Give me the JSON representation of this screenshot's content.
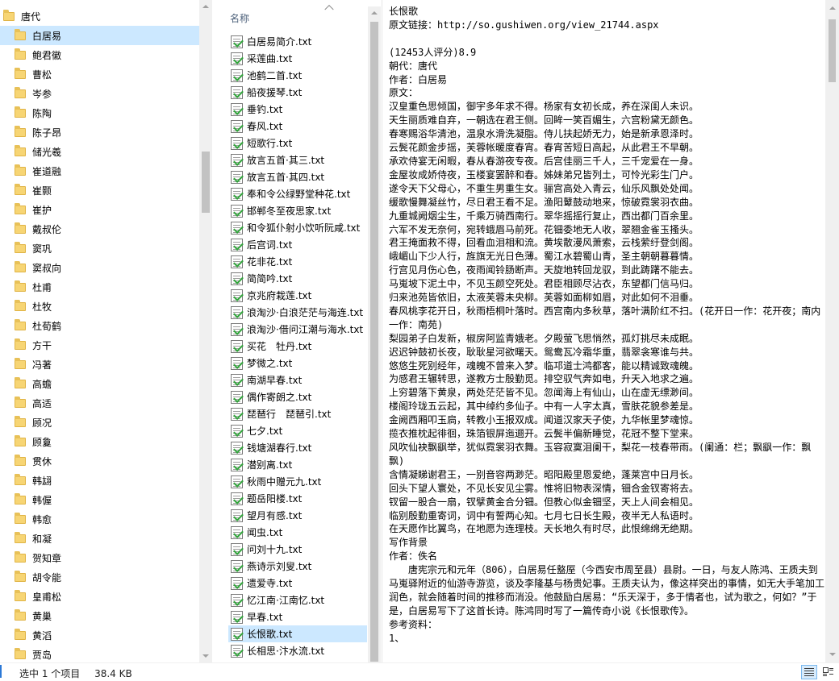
{
  "folder_tree": {
    "root": "唐代",
    "items": [
      "白居易",
      "鲍君徽",
      "曹松",
      "岑参",
      "陈陶",
      "陈子昂",
      "储光羲",
      "崔道融",
      "崔颢",
      "崔护",
      "戴叔伦",
      "窦巩",
      "窦叔向",
      "杜甫",
      "杜牧",
      "杜荀鹤",
      "方干",
      "冯著",
      "高蟾",
      "高适",
      "顾况",
      "顾敻",
      "贯休",
      "韩翃",
      "韩偓",
      "韩愈",
      "和凝",
      "贺知章",
      "胡令能",
      "皇甫松",
      "黄巢",
      "黄滔",
      "贾岛"
    ],
    "selected_index": 0
  },
  "file_list": {
    "column_header": "名称",
    "items": [
      "白居易简介.txt",
      "采莲曲.txt",
      "池鹤二首.txt",
      "船夜援琴.txt",
      "垂钓.txt",
      "春风.txt",
      "短歌行.txt",
      "放言五首·其三.txt",
      "放言五首·其四.txt",
      "奉和令公绿野堂种花.txt",
      "邯郸冬至夜思家.txt",
      "和令狐仆射小饮听阮咸.txt",
      "后宫词.txt",
      "花非花.txt",
      "简简吟.txt",
      "京兆府栽莲.txt",
      "浪淘沙·白浪茫茫与海连.txt",
      "浪淘沙·借问江潮与海水.txt",
      "买花　牡丹.txt",
      "梦微之.txt",
      "南湖早春.txt",
      "偶作寄朗之.txt",
      "琵琶行　琵琶引.txt",
      "七夕.txt",
      "钱塘湖春行.txt",
      "潜别离.txt",
      "秋雨中赠元九.txt",
      "题岳阳楼.txt",
      "望月有感.txt",
      "闻虫.txt",
      "问刘十九.txt",
      "燕诗示刘叟.txt",
      "遗爱寺.txt",
      "忆江南·江南忆.txt",
      "早春.txt",
      "长恨歌.txt",
      "长相思·汴水流.txt"
    ],
    "selected_index": 35
  },
  "preview": {
    "lines": [
      "长恨歌",
      "原文链接：http://so.gushiwen.org/view_21744.aspx",
      "",
      "(12453人评分)8.9",
      "朝代：唐代",
      "作者：白居易",
      "原文：",
      "汉皇重色思倾国，御宇多年求不得。杨家有女初长成，养在深闺人未识。",
      "天生丽质难自弃，一朝选在君王侧。回眸一笑百媚生，六宫粉黛无颜色。",
      "春寒赐浴华清池，温泉水滑洗凝脂。侍儿扶起娇无力，始是新承恩泽时。",
      "云鬓花颜金步摇，芙蓉帐暖度春宵。春宵苦短日高起，从此君王不早朝。",
      "承欢侍宴无闲暇，春从春游夜专夜。后宫佳丽三千人，三千宠爱在一身。",
      "金屋妆成娇侍夜，玉楼宴罢醉和春。姊妹弟兄皆列土，可怜光彩生门户。",
      "遂令天下父母心，不重生男重生女。骊宫高处入青云，仙乐风飘处处闻。",
      "缓歌慢舞凝丝竹，尽日君王看不足。渔阳鼙鼓动地来，惊破霓裳羽衣曲。",
      "九重城阙烟尘生，千乘万骑西南行。翠华摇摇行复止，西出都门百余里。",
      "六军不发无奈何，宛转蛾眉马前死。花钿委地无人收，翠翘金雀玉搔头。",
      "君王掩面救不得，回看血泪相和流。黄埃散漫风萧索，云栈萦纡登剑阁。",
      "峨嵋山下少人行，旌旗无光日色薄。蜀江水碧蜀山青，圣主朝朝暮暮情。",
      "行宫见月伤心色，夜雨闻铃肠断声。天旋地转回龙驭，到此踌躇不能去。",
      "马嵬坡下泥土中，不见玉颜空死处。君臣相顾尽沾衣，东望都门信马归。",
      "归来池苑皆依旧，太液芙蓉未央柳。芙蓉如面柳如眉，对此如何不泪垂。",
      "春风桃李花开日，秋雨梧桐叶落时。西宫南内多秋草，落叶满阶红不扫。(花开日一作：花开夜；南内一作：南苑)",
      "梨园弟子白发新，椒房阿监青娥老。夕殿萤飞思悄然，孤灯挑尽未成眠。",
      "迟迟钟鼓初长夜，耿耿星河欲曙天。鸳鸯瓦冷霜华重，翡翠衾寒谁与共。",
      "悠悠生死别经年，魂魄不曾来入梦。临邛道士鸿都客，能以精诚致魂魄。",
      "为感君王辗转思，遂教方士殷勤觅。排空驭气奔如电，升天入地求之遍。",
      "上穷碧落下黄泉，两处茫茫皆不见。忽闻海上有仙山，山在虚无缥渺间。",
      "楼阁玲珑五云起，其中绰约多仙子。中有一人字太真，雪肤花貌参差是。",
      "金阙西厢叩玉扃，转教小玉报双成。闻道汉家天子使，九华帐里梦魂惊。",
      "揽衣推枕起徘徊，珠箔银屏迤逦开。云鬓半偏新睡觉，花冠不整下堂来。",
      "风吹仙袂飘飖举，犹似霓裳羽衣舞。玉容寂寞泪阑干，梨花一枝春带雨。(阑通：栏；飘飖一作：飘飘)",
      "含情凝睇谢君王，一别音容两渺茫。昭阳殿里恩爱绝，蓬莱宫中日月长。",
      "回头下望人寰处，不见长安见尘雾。惟将旧物表深情，钿合金钗寄将去。",
      "钗留一股合一扇，钗擘黄金合分钿。但教心似金钿坚，天上人间会相见。",
      "临别殷勤重寄词，词中有誓两心知。七月七日长生殿，夜半无人私语时。",
      "在天愿作比翼鸟，在地愿为连理枝。天长地久有时尽，此恨绵绵无绝期。",
      "写作背景",
      "作者：佚名",
      "　　唐宪宗元和元年（806），白居易任盩厔（今西安市周至县）县尉。一日，与友人陈鸿、王质夫到马嵬驿附近的仙游寺游览，谈及李隆基与杨贵妃事。王质夫认为，像这样突出的事情，如无大手笔加工润色，就会随着时间的推移而消没。他鼓励白居易：“乐天深于，多于情者也，试为歌之，何如？”于是，白居易写下了这首长诗。陈鸿同时写了一篇传奇小说《长恨歌传》。",
      "参考资料：",
      "1、"
    ]
  },
  "status_bar": {
    "selection_text": "选中 1 个项目",
    "size_text": "38.4 KB"
  }
}
